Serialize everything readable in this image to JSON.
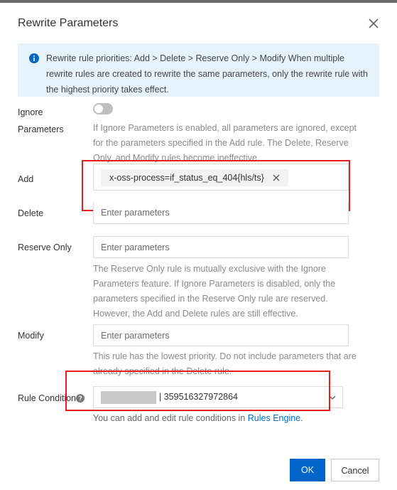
{
  "dialog": {
    "title": "Rewrite Parameters",
    "close_icon": "close-icon"
  },
  "info": {
    "icon": "info-icon",
    "text": "Rewrite rule priorities: Add > Delete > Reserve Only > Modify When multiple rewrite rules are created to rewrite the same parameters, only the rewrite rule with the highest priority takes effect."
  },
  "ignore": {
    "label_line1": "Ignore",
    "label_line2": "Parameters",
    "toggle_on": false,
    "help": "If Ignore Parameters is enabled, all parameters are ignored, except for the parameters specified in the Add rule. The Delete, Reserve Only, and Modify rules become ineffective."
  },
  "add": {
    "label": "Add",
    "tag": "x-oss-process=if_status_eq_404{hls/ts}"
  },
  "delete": {
    "label": "Delete",
    "placeholder": "Enter parameters"
  },
  "reserve_only": {
    "label": "Reserve Only",
    "placeholder": "Enter parameters",
    "help": "The Reserve Only rule is mutually exclusive with the Ignore Parameters feature. If Ignore Parameters is disabled, only the parameters specified in the Reserve Only rule are reserved. However, the Add and Delete rules are still effective."
  },
  "modify": {
    "label": "Modify",
    "placeholder": "Enter parameters",
    "help": "This rule has the lowest priority. Do not include parameters that are already specified in the Delete rule."
  },
  "rule_condition": {
    "label": "Rule Condition",
    "help_icon": "question-icon",
    "value": "| 359516327972864",
    "help_prefix": "You can add and edit rule conditions in ",
    "help_link": "Rules Engine",
    "help_suffix": "."
  },
  "footer": {
    "ok_label": "OK",
    "cancel_label": "Cancel"
  },
  "colors": {
    "primary": "#0064c8",
    "info_bg": "#e6f3fd",
    "highlight": "#e81e1e",
    "link": "#0070cc"
  }
}
